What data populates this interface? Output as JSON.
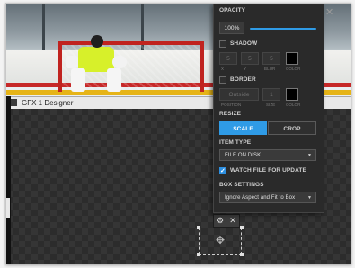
{
  "window": {
    "title": "GFX 1 Designer"
  },
  "close_glyph": "✕",
  "properties": {
    "opacity": {
      "label": "OPACITY",
      "value": "100%",
      "level": 1.0
    },
    "shadow": {
      "label": "SHADOW",
      "checked": false,
      "fields": [
        {
          "value": "5",
          "caption": "X"
        },
        {
          "value": "5",
          "caption": "Y"
        },
        {
          "value": "5",
          "caption": "BLUR"
        }
      ],
      "color_caption": "COLOR",
      "color": "#000000"
    },
    "border": {
      "label": "BORDER",
      "checked": false,
      "position": {
        "value": "Outside",
        "caption": "POSITION"
      },
      "size": {
        "value": "1",
        "caption": "SIZE"
      },
      "color_caption": "COLOR",
      "color": "#000000"
    },
    "resize": {
      "label": "RESIZE",
      "options": [
        "SCALE",
        "CROP"
      ],
      "selected": "SCALE"
    },
    "item_type": {
      "label": "ITEM TYPE",
      "value": "FILE ON DISK"
    },
    "watch_file": {
      "label": "WATCH FILE FOR UPDATE",
      "checked": true,
      "check_glyph": "✓"
    },
    "box_settings": {
      "label": "BOX SETTINGS",
      "value": "Ignore Aspect and Fit to Box"
    },
    "caret_glyph": "▼"
  },
  "element_tools": {
    "settings_icon": "⚙",
    "close_icon": "✕",
    "move_icon": "✥"
  },
  "colors": {
    "accent": "#2f9be6",
    "panel_bg": "#2a2a2a"
  }
}
